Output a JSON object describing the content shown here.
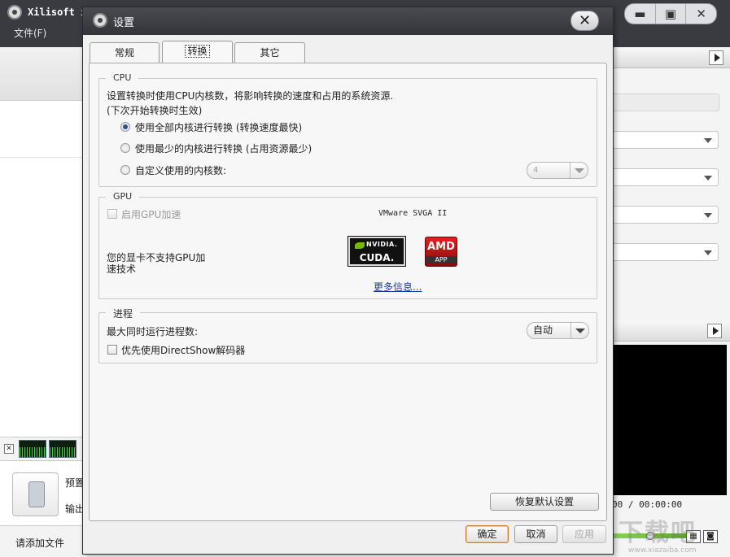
{
  "app": {
    "title": "Xilisoft i",
    "menu_file": "文件(F)",
    "win_minimize": "▬",
    "win_maximize": "▣",
    "win_close": "✕",
    "time_readout": "00 / 00:00:00",
    "preset_label": "预置",
    "output_label": "输出",
    "status_text": "请添加文件",
    "bottom_close": "✕",
    "watermark": "下载吧",
    "watermark_url": "www.xiazaiba.com"
  },
  "dialog": {
    "title": "设置",
    "close_symbol": "✕",
    "tabs": [
      {
        "label": "常规"
      },
      {
        "label": "转换"
      },
      {
        "label": "其它"
      }
    ],
    "cpu": {
      "legend": "CPU",
      "desc_line1": "设置转换时使用CPU内核数，将影响转换的速度和占用的系统资源.",
      "desc_line2": "(下次开始转换时生效)",
      "options": [
        {
          "label": "使用全部内核进行转换 (转换速度最快)",
          "checked": true
        },
        {
          "label": "使用最少的内核进行转换 (占用资源最少)",
          "checked": false
        },
        {
          "label": "自定义使用的内核数:",
          "checked": false
        }
      ],
      "custom_cores_value": "4"
    },
    "gpu": {
      "legend": "GPU",
      "enable_label": "启用GPU加速",
      "adapter_name": "VMware SVGA II",
      "unsupported_line1": "您的显卡不支持GPU加",
      "unsupported_line2": "速技术",
      "nvidia_brand": "NVIDIA.",
      "nvidia_product": "CUDA.",
      "amd_brand": "AMD",
      "amd_product": "APP",
      "more_info": "更多信息..."
    },
    "process": {
      "legend": "进程",
      "max_label": "最大同时运行进程数:",
      "max_value": "自动",
      "directshow_label": "优先使用DirectShow解码器"
    },
    "restore_defaults": "恢复默认设置",
    "ok": "确定",
    "cancel": "取消",
    "apply": "应用"
  }
}
